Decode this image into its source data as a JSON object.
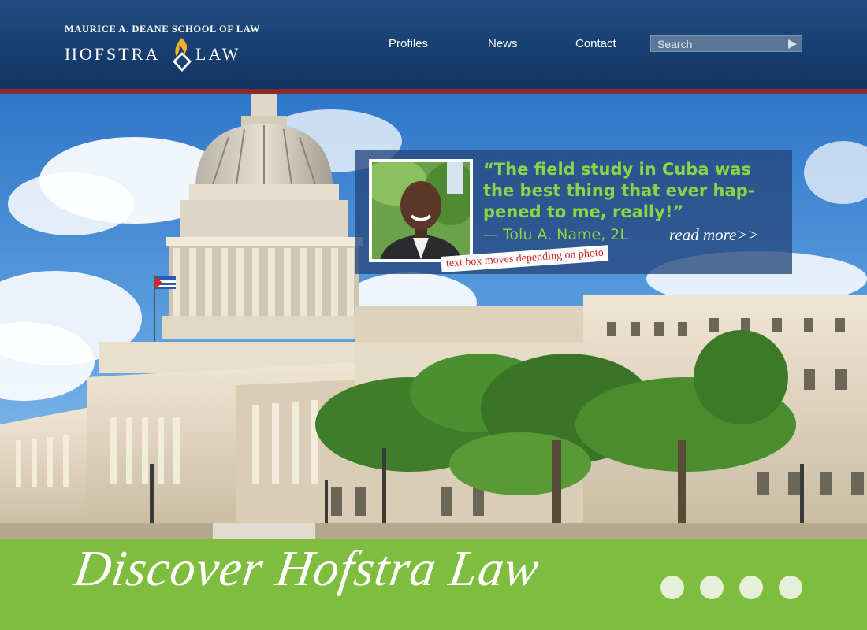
{
  "header": {
    "logo": {
      "school_line": "MAURICE A. DEANE SCHOOL OF LAW",
      "name_left": "HOFSTRA",
      "name_right": "LAW"
    },
    "nav": [
      {
        "label": "Profiles"
      },
      {
        "label": "News"
      },
      {
        "label": "Contact"
      }
    ],
    "search": {
      "placeholder": "Search",
      "button_icon": "play-triangle-icon"
    }
  },
  "hero": {
    "quote": {
      "text": "“The field study in Cuba was the best thing that  ever hap­pened to me, really!”",
      "attribution": "— Tolu A. Name, 2L",
      "read_more": "read more>>"
    },
    "annotation": "text box moves depending on photo"
  },
  "footer_band": {
    "tagline": "Discover Hofstra Law",
    "slide_dots": 4,
    "active_dot": 0
  },
  "colors": {
    "header_blue": "#173f70",
    "accent_red": "#8a2a2a",
    "quote_green": "#8bd446",
    "band_green": "#7ebd3d",
    "logo_gold": "#f2b12b"
  }
}
